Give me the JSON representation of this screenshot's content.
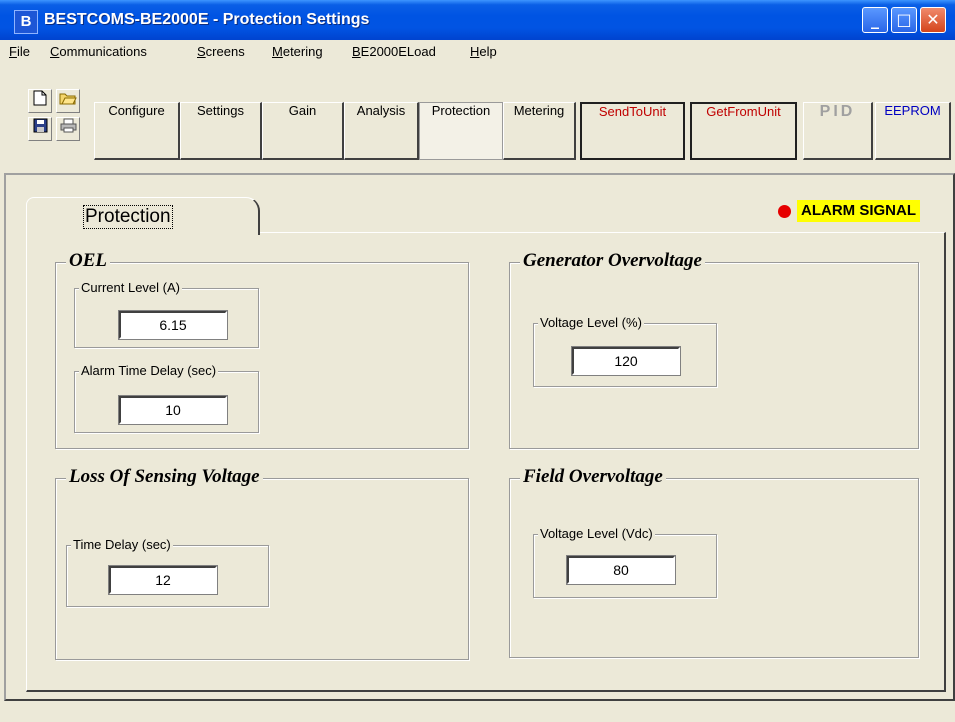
{
  "window": {
    "title": "BESTCOMS-BE2000E - Protection Settings",
    "app_icon": "B",
    "minimize": "_",
    "maximize": "□",
    "close": "✕"
  },
  "menu": {
    "items": [
      "File",
      "Communications",
      "Screens",
      "Metering",
      "BE2000ELoad",
      "Help"
    ]
  },
  "toolbar": {
    "icons": [
      "new-document-icon",
      "open-folder-icon",
      "save-disk-icon",
      "print-icon"
    ],
    "buttons": [
      "Configure",
      "Settings",
      "Gain",
      "Analysis",
      "Protection",
      "Metering",
      "SendToUnit",
      "GetFromUnit",
      "PID",
      "EEPROM"
    ],
    "active": "Protection",
    "colors": {
      "red_button": "#c00000",
      "eeprom_button": "#0000c0",
      "disabled": "#a0a0a0"
    }
  },
  "tab": {
    "label": "Protection"
  },
  "alarm": {
    "label": "ALARM SIGNAL",
    "dot_color": "#e60000",
    "bg": "#ffff00"
  },
  "groups": {
    "oel": {
      "title": "OEL",
      "current_level_label": "Current Level (A)",
      "current_level_value": "6.15",
      "alarm_delay_label": "Alarm Time Delay (sec)",
      "alarm_delay_value": "10"
    },
    "generator_overvoltage": {
      "title": "Generator Overvoltage",
      "voltage_label": "Voltage Level (%)",
      "voltage_value": "120"
    },
    "loss_of_sensing": {
      "title": "Loss Of Sensing Voltage",
      "delay_label": "Time Delay (sec)",
      "delay_value": "12"
    },
    "field_overvoltage": {
      "title": "Field Overvoltage",
      "voltage_label": "Voltage Level (Vdc)",
      "voltage_value": "80"
    }
  }
}
